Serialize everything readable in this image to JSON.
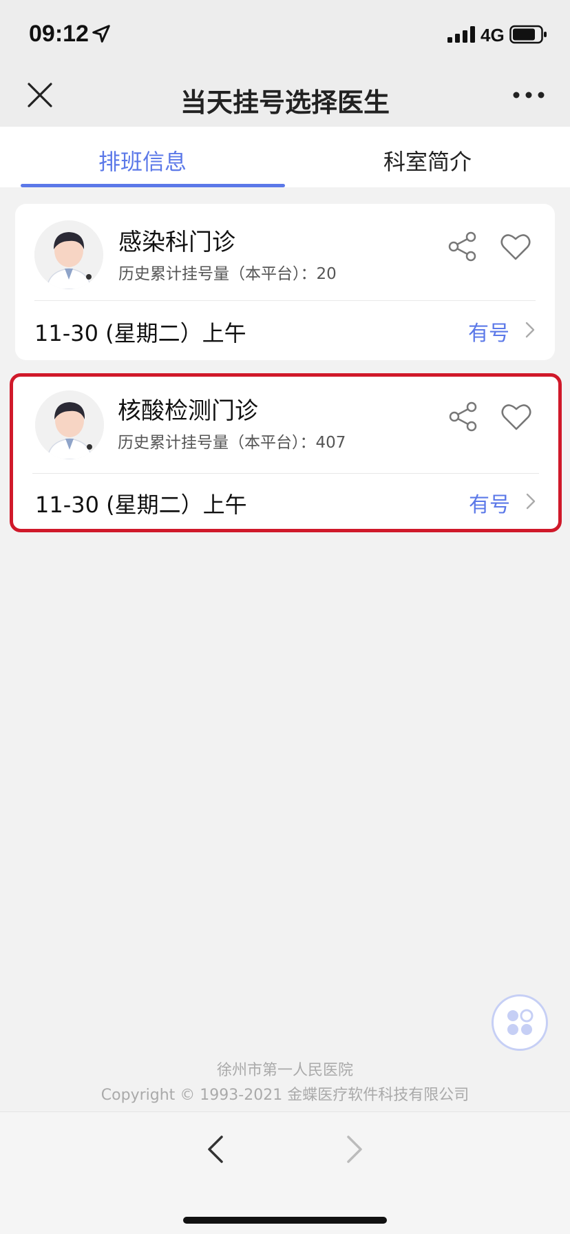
{
  "status_bar": {
    "time": "09:12",
    "network": "4G"
  },
  "nav": {
    "title": "当天挂号选择医生"
  },
  "tabs": [
    {
      "label": "排班信息",
      "active": true
    },
    {
      "label": "科室简介",
      "active": false
    }
  ],
  "doctors": [
    {
      "name": "感染科门诊",
      "history_label": "历史累计挂号量（本平台）：",
      "history_count": "20",
      "schedule": "11-30 (星期二）上午",
      "availability": "有号",
      "highlighted": false
    },
    {
      "name": "核酸检测门诊",
      "history_label": "历史累计挂号量（本平台）：",
      "history_count": "407",
      "schedule": "11-30 (星期二）上午",
      "availability": "有号",
      "highlighted": true
    }
  ],
  "footer": {
    "hospital": "徐州市第一人民医院",
    "copyright": "Copyright © 1993-2021 金蝶医疗软件科技有限公司"
  },
  "colors": {
    "accent": "#5b78e8",
    "highlight_border": "#d0192a",
    "background": "#f2f2f2"
  },
  "icons": [
    "location-arrow-icon",
    "signal-icon",
    "battery-icon",
    "close-icon",
    "more-icon",
    "share-icon",
    "heart-icon",
    "chevron-right-icon",
    "apps-icon",
    "back-arrow-icon",
    "forward-arrow-icon"
  ]
}
